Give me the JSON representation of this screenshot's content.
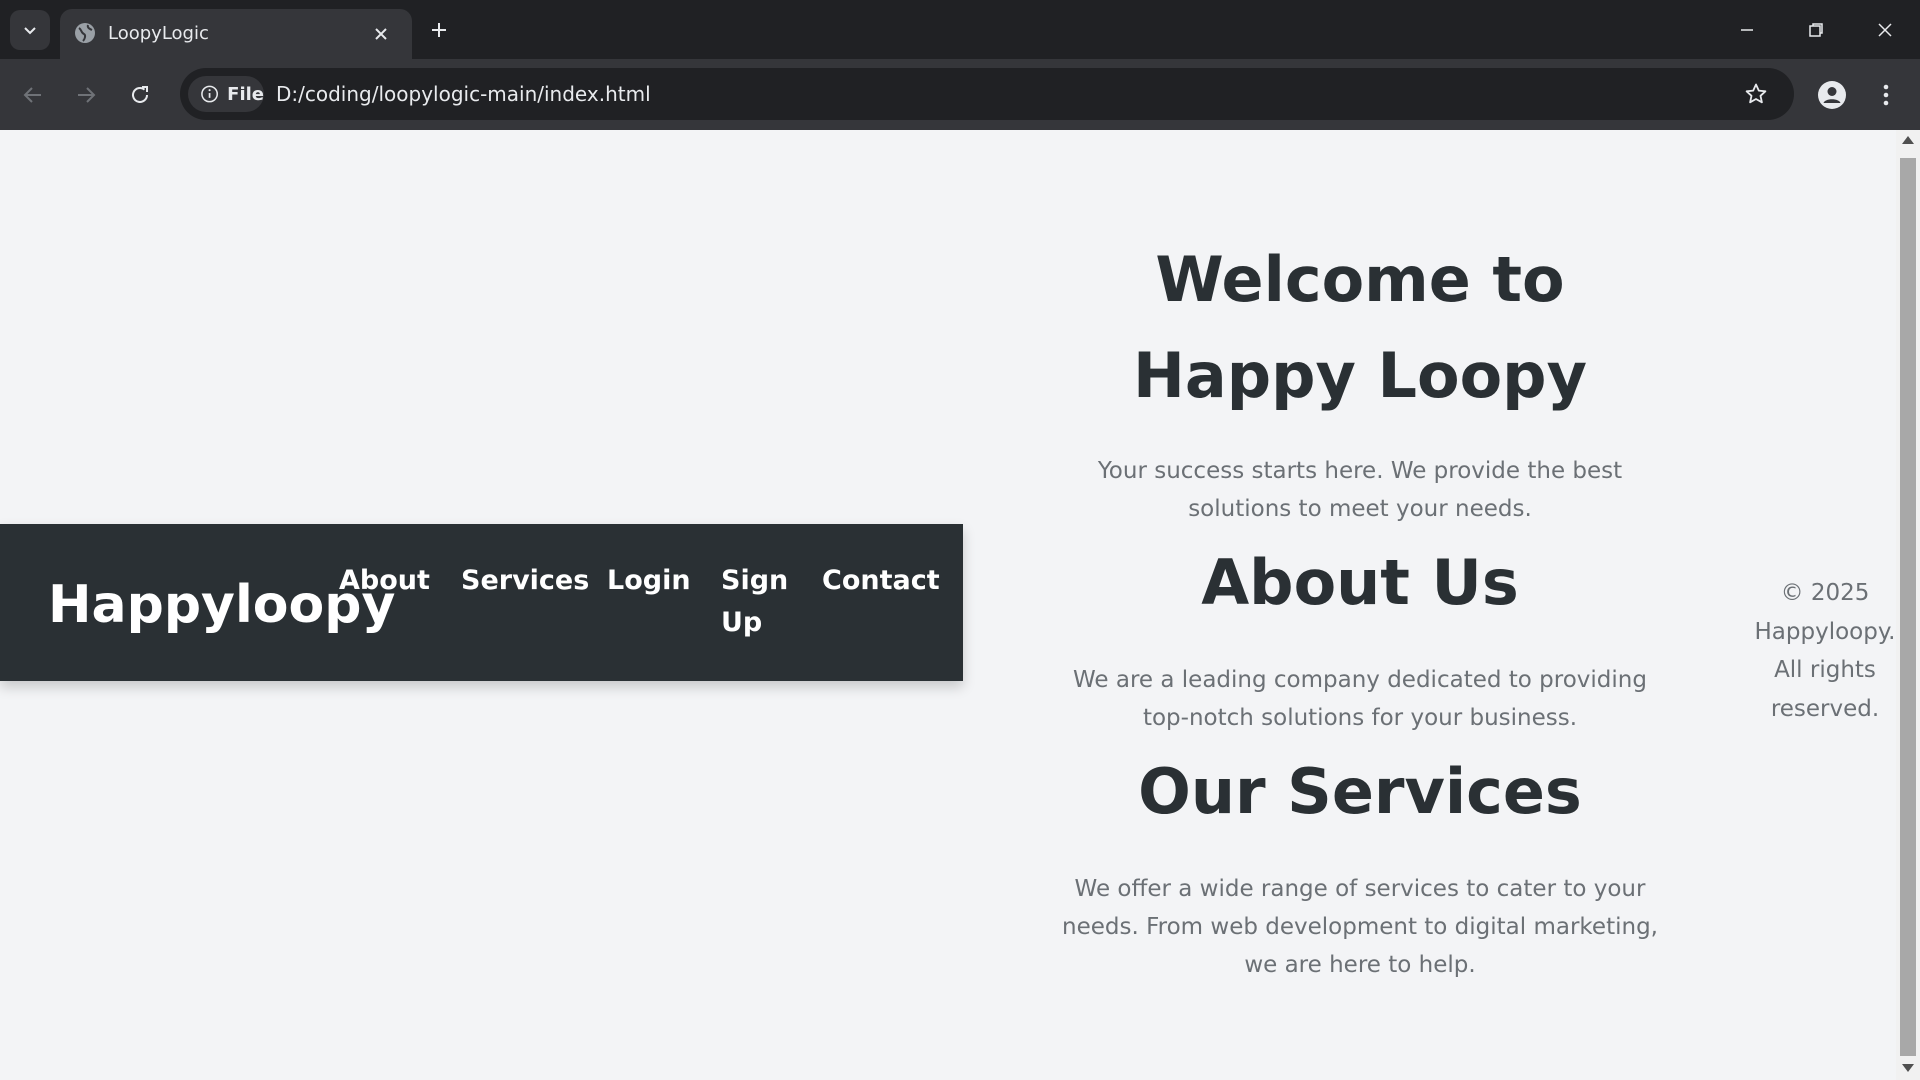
{
  "browser": {
    "tab_title": "LoopyLogic",
    "url": "D:/coding/loopylogic-main/index.html",
    "file_chip_label": "File"
  },
  "site": {
    "brand": "Happyloopy",
    "nav": {
      "about": "About",
      "services": "Services",
      "login": "Login",
      "signup": "Sign Up",
      "contact": "Contact"
    },
    "welcome": {
      "title": "Welcome to Happy Loopy",
      "text": "Your success starts here. We provide the best solutions to meet your needs."
    },
    "about": {
      "title": "About Us",
      "text": "We are a leading company dedicated to providing top-notch solutions for your business."
    },
    "services": {
      "title": "Our Services",
      "text": "We offer a wide range of services to cater to your needs. From web development to digital marketing, we are here to help."
    },
    "footer": "© 2025 Happyloopy. All rights reserved."
  },
  "colors": {
    "chrome_dark": "#202124",
    "chrome_toolbar": "#35363a",
    "page_bg": "#f3f4f6",
    "navbar_bg": "#2a3034",
    "heading_text": "#2a3034",
    "body_text": "#6b7075"
  }
}
